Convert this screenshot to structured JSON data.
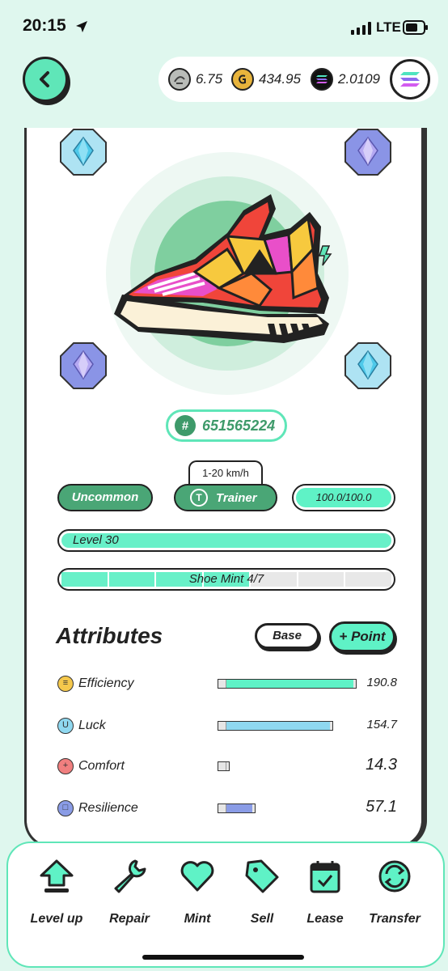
{
  "status_bar": {
    "time": "20:15",
    "network": "LTE"
  },
  "header": {
    "currencies": [
      {
        "name": "GST",
        "icon": "green-token-icon",
        "value": "6.75"
      },
      {
        "name": "GMT",
        "icon": "gold-token-icon",
        "value": "434.95"
      },
      {
        "name": "SOL",
        "icon": "solana-icon",
        "value": "2.0109"
      }
    ]
  },
  "sneaker": {
    "id": "651565224",
    "id_prefix": "#",
    "speed_range": "1-20 km/h",
    "rarity": "Uncommon",
    "type": "Trainer",
    "type_icon_letter": "T",
    "durability": "100.0/100.0",
    "durability_fraction": 1.0,
    "level": "Level 30",
    "level_fraction": 1.0,
    "shoe_mint": "Shoe Mint 4/7",
    "mint_used": 4,
    "mint_total": 7
  },
  "attributes": {
    "title": "Attributes",
    "base_label": "Base",
    "point_label": "+ Point",
    "items": [
      {
        "name": "Efficiency",
        "value": "190.8",
        "icon_glyph": "≡",
        "icon_color": "#f5c84c",
        "bar_color": "#5ff2c6",
        "bar_fraction": 0.98
      },
      {
        "name": "Luck",
        "value": "154.7",
        "icon_glyph": "U",
        "icon_color": "#8fd8f0",
        "bar_color": "#8fd8f0",
        "bar_fraction": 0.8
      },
      {
        "name": "Comfort",
        "value": "14.3",
        "icon_glyph": "+",
        "icon_color": "#f07f7f",
        "bar_color": "#f07f7f",
        "bar_fraction": 0.0
      },
      {
        "name": "Resilience",
        "value": "57.1",
        "icon_glyph": "□",
        "icon_color": "#8a9ce6",
        "bar_color": "#8a9ce6",
        "bar_fraction": 0.2
      }
    ]
  },
  "actions": [
    {
      "label": "Level up",
      "icon": "level-up-arrow-icon"
    },
    {
      "label": "Repair",
      "icon": "wrench-icon"
    },
    {
      "label": "Mint",
      "icon": "heart-icon"
    },
    {
      "label": "Sell",
      "icon": "price-tag-icon"
    },
    {
      "label": "Lease",
      "icon": "calendar-icon"
    },
    {
      "label": "Transfer",
      "icon": "transfer-icon"
    }
  ],
  "colors": {
    "accent": "#5ff2c6",
    "dark_green": "#4aa676",
    "background": "#dff7ee"
  }
}
